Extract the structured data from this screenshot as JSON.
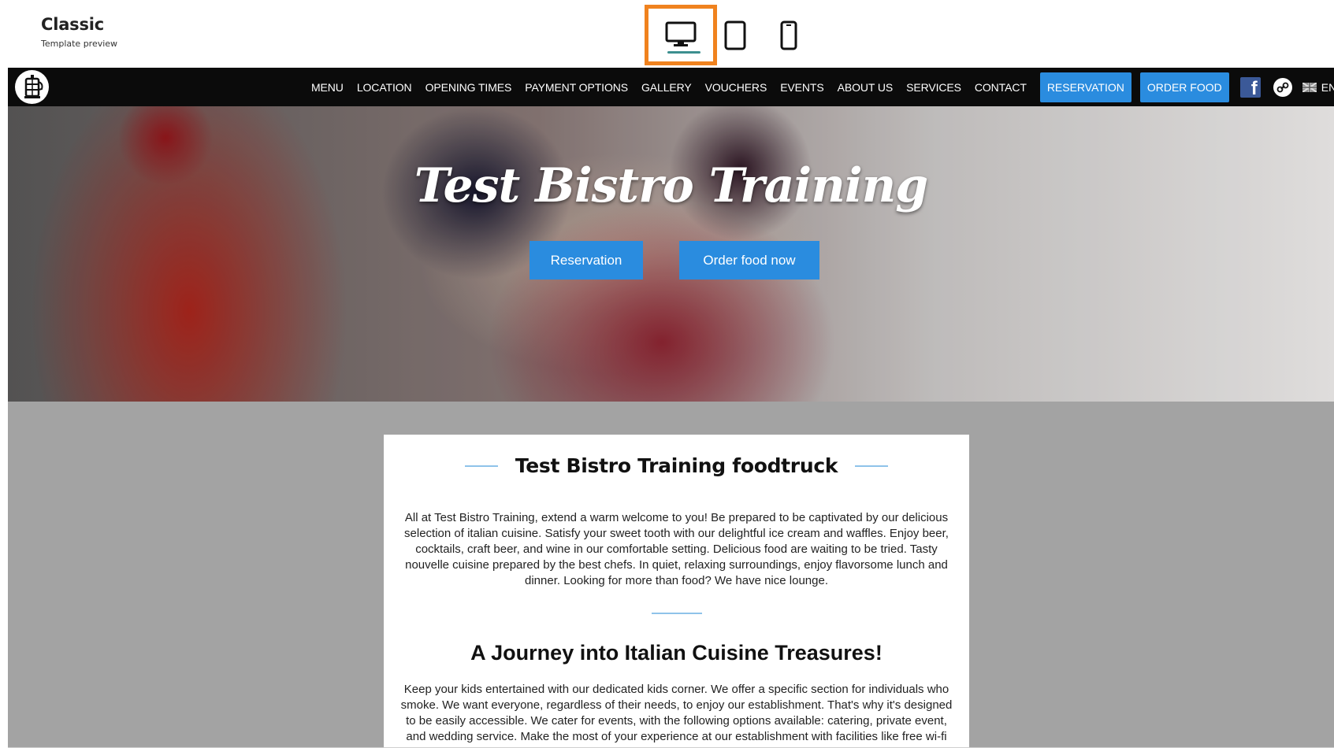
{
  "editor": {
    "template_name": "Classic",
    "template_subtitle": "Template preview",
    "devices": [
      {
        "name": "desktop",
        "icon": "desktop-icon",
        "selected": true
      },
      {
        "name": "tablet",
        "icon": "tablet-icon",
        "selected": false
      },
      {
        "name": "mobile",
        "icon": "mobile-icon",
        "selected": false
      }
    ],
    "highlight_color": "#f0821e"
  },
  "site": {
    "nav": {
      "links": [
        "MENU",
        "LOCATION",
        "OPENING TIMES",
        "PAYMENT OPTIONS",
        "GALLERY",
        "VOUCHERS",
        "EVENTS",
        "ABOUT US",
        "SERVICES",
        "CONTACT"
      ],
      "reservation_label": "RESERVATION",
      "order_label": "ORDER FOOD",
      "language": "ENGLISH",
      "accent_color": "#2a8cdf"
    },
    "hero": {
      "title": "Test Bistro Training",
      "reservation_button": "Reservation",
      "order_button": "Order food now"
    },
    "content": {
      "title": "Test Bistro Training foodtruck",
      "intro": "All at Test Bistro Training, extend a warm welcome to you! Be prepared to be captivated by our delicious selection of italian cuisine. Satisfy your sweet tooth with our delightful ice cream and waffles. Enjoy beer, cocktails, craft beer, and wine in our comfortable setting. Delicious food are waiting to be tried. Tasty nouvelle cuisine prepared by the best chefs. In quiet, relaxing surroundings, enjoy flavorsome lunch and dinner. Looking for more than food? We have nice lounge.",
      "heading": "A Journey into Italian Cuisine Treasures!",
      "body": "Keep your kids entertained with our dedicated kids corner. We offer a specific section for individuals who smoke. We want everyone, regardless of their needs, to enjoy our establishment. That's why it's designed to be easily accessible. We cater for events, with the following options available: catering, private event, and wedding service. Make the most of your experience at our establishment with facilities like free wi-fi and more."
    }
  }
}
